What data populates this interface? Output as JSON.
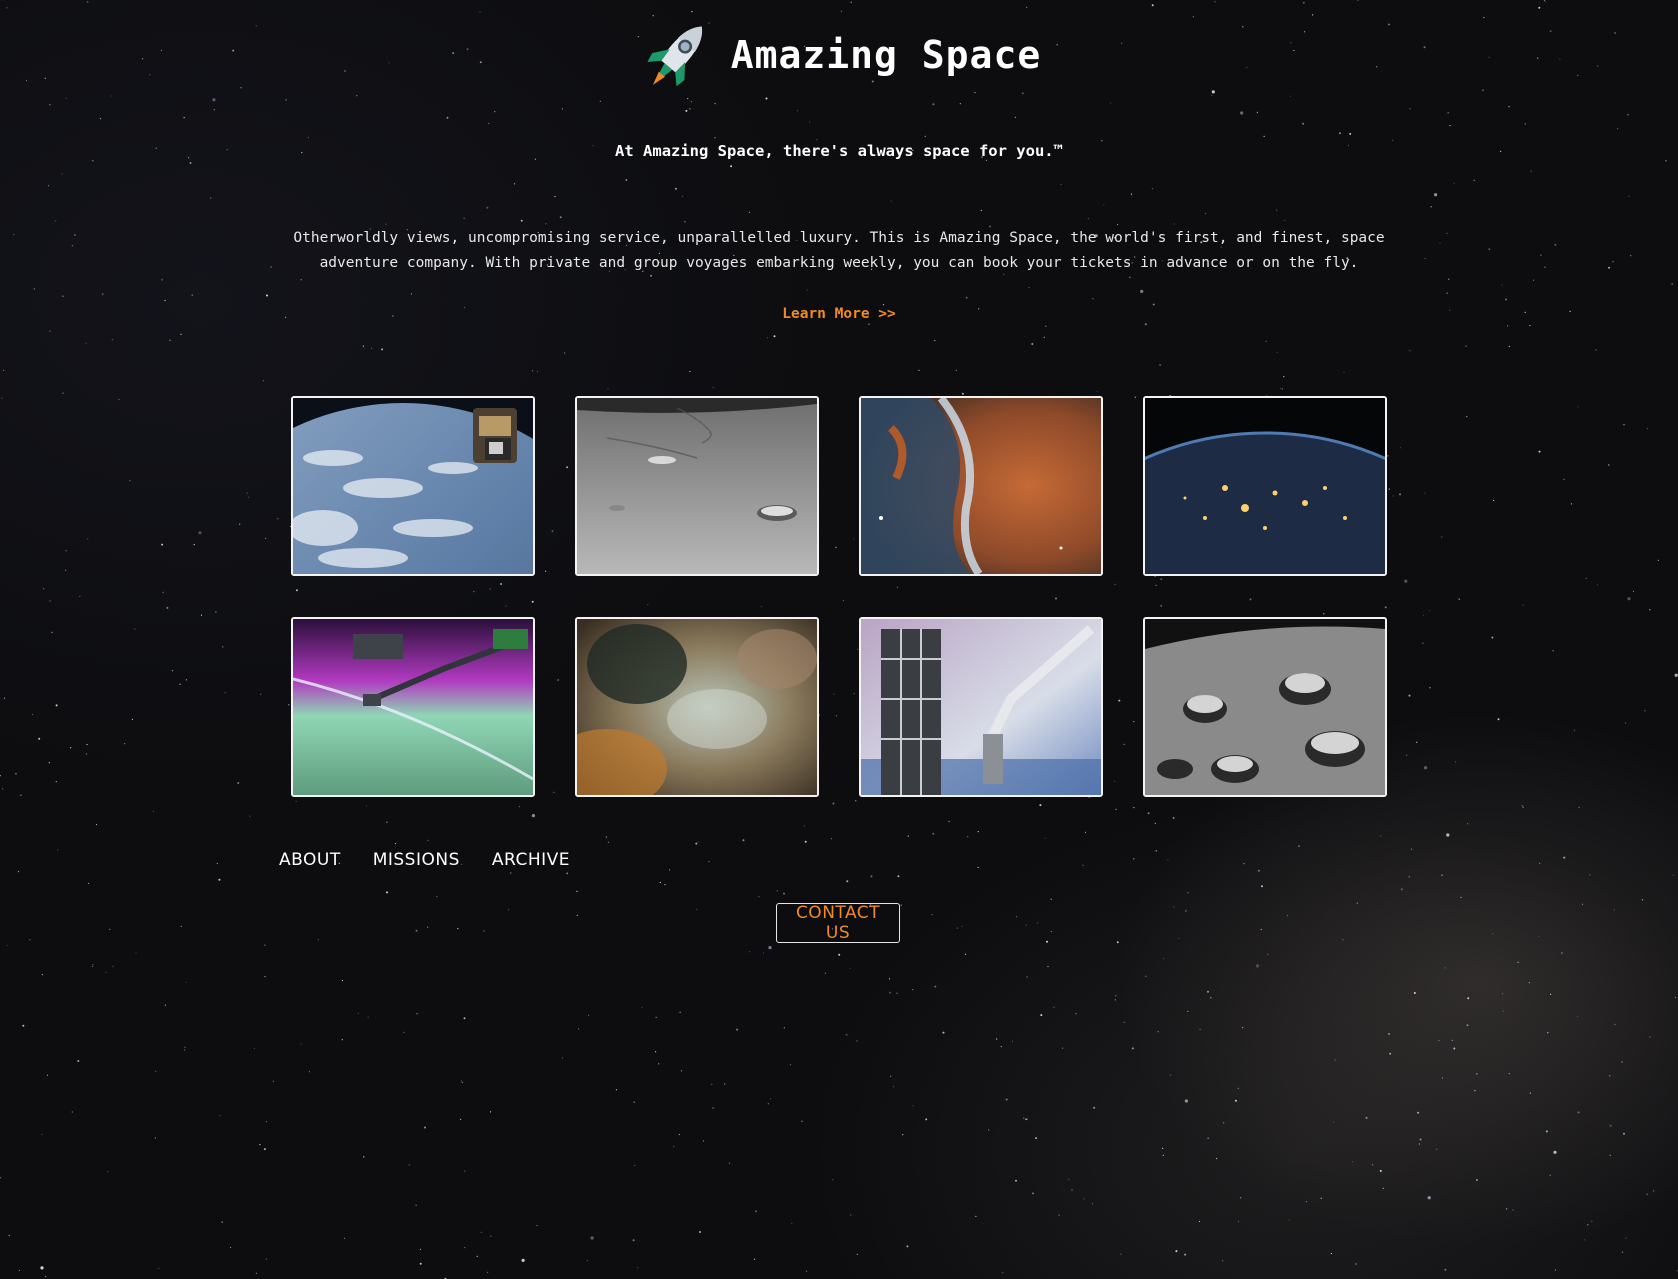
{
  "header": {
    "title": "Amazing Space",
    "logo_icon": "rocket-icon"
  },
  "tagline": "At Amazing Space, there's always space for you.™",
  "intro": "Otherworldly views, uncompromising service, unparallelled luxury. This is Amazing Space, the world's first, and finest, space adventure company. With private and group voyages embarking weekly, you can book your tickets in advance or on the fly.",
  "learn_more": "Learn More >>",
  "gallery": [
    {
      "subject": "earth-from-station"
    },
    {
      "subject": "lunar-surface"
    },
    {
      "subject": "nebula-orange-blue"
    },
    {
      "subject": "earth-night-lights"
    },
    {
      "subject": "aurora-robotic-arm"
    },
    {
      "subject": "nebula-dust"
    },
    {
      "subject": "hubble-telescope"
    },
    {
      "subject": "lunar-craters"
    }
  ],
  "nav": {
    "items": [
      "ABOUT",
      "MISSIONS",
      "ARCHIVE"
    ]
  },
  "contact_label": "CONTACT US",
  "colors": {
    "accent": "#f08a24",
    "background": "#0d0d10",
    "text": "#ffffff"
  }
}
